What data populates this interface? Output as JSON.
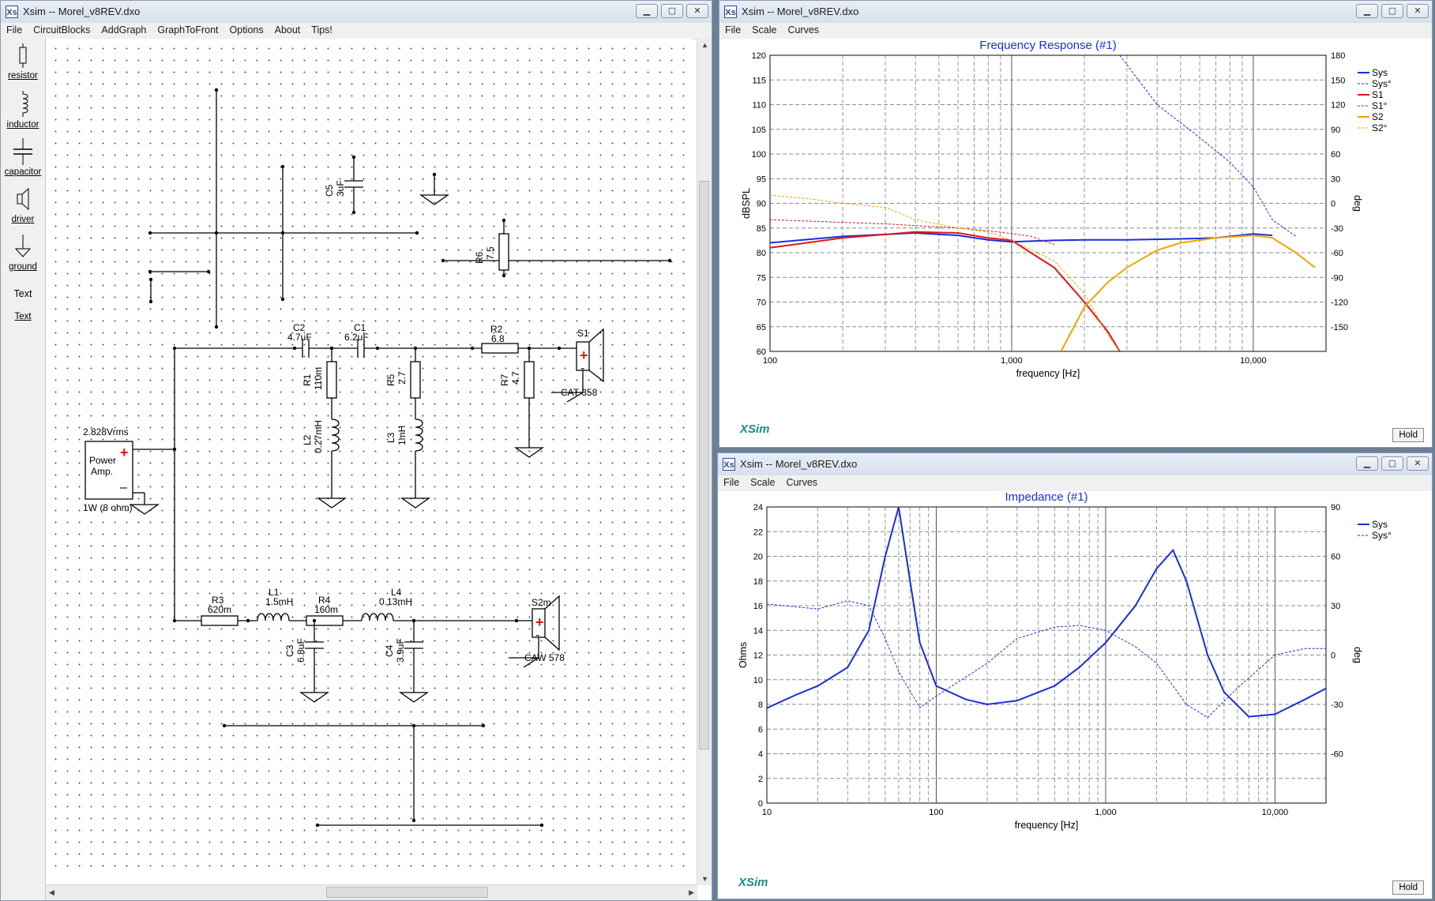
{
  "left_window": {
    "title": "Xsim -- Morel_v8REV.dxo",
    "menu": [
      "File",
      "CircuitBlocks",
      "AddGraph",
      "GraphToFront",
      "Options",
      "About",
      "Tips!"
    ],
    "palette": [
      {
        "label": "resistor",
        "icon": "resistor-icon"
      },
      {
        "label": "inductor",
        "icon": "inductor-icon"
      },
      {
        "label": "capacitor",
        "icon": "capacitor-icon"
      },
      {
        "label": "driver",
        "icon": "speaker-icon"
      },
      {
        "label": "ground",
        "icon": "ground-icon"
      },
      {
        "label": "Text",
        "icon": "text-tool"
      },
      {
        "label": "Text",
        "icon": "text-tool"
      }
    ],
    "schematic": {
      "c5": {
        "ref": "C5",
        "value": "3uF"
      },
      "r6": {
        "ref": "R6",
        "value": "7.5"
      },
      "c2": {
        "ref": "C2",
        "value": "4.7uF"
      },
      "c1": {
        "ref": "C1",
        "value": "6.2uF"
      },
      "r2": {
        "ref": "R2",
        "value": "6.8"
      },
      "s1": {
        "ref": "S1",
        "model": "CAT 358"
      },
      "r1": {
        "ref": "R1",
        "value": "110m"
      },
      "r5": {
        "ref": "R5",
        "value": "2.7"
      },
      "r7": {
        "ref": "R7",
        "value": "4.7"
      },
      "l2": {
        "ref": "L2",
        "value": "0.27mH"
      },
      "l3": {
        "ref": "L3",
        "value": "1mH"
      },
      "amp": {
        "voltage": "2.828Vrms",
        "label_line1": "Power",
        "label_line2": "Amp.",
        "power": "1W (8 ohm)"
      },
      "r3": {
        "ref": "R3",
        "value": "620m"
      },
      "l1": {
        "ref": "L1",
        "value": "1.5mH"
      },
      "r4": {
        "ref": "R4",
        "value": "160m"
      },
      "l4": {
        "ref": "L4",
        "value": "0.13mH"
      },
      "s2": {
        "ref": "S2m",
        "model": "CAW 578"
      },
      "c3": {
        "ref": "C3",
        "value": "6.8uF"
      },
      "c4": {
        "ref": "C4",
        "value": "3.9uF"
      }
    }
  },
  "freq_window": {
    "title": "Xsim -- Morel_v8REV.dxo",
    "menu": [
      "File",
      "Scale",
      "Curves"
    ],
    "hold_label": "Hold",
    "brand": "XSim",
    "chart_data": {
      "type": "line",
      "title": "Frequency Response (#1)",
      "xlabel": "frequency [Hz]",
      "ylabel": "dBSPL",
      "y2label": "deg",
      "x_scale": "log",
      "xlim": [
        100,
        20000
      ],
      "ylim": [
        60,
        120
      ],
      "y2lim": [
        -180,
        180
      ],
      "x_tick_labels": [
        "100",
        "1,000",
        "10,000"
      ],
      "x_ticks": [
        100,
        1000,
        10000
      ],
      "y_ticks": [
        "120",
        "115",
        "110",
        "105",
        "100",
        "95",
        "90",
        "85",
        "80",
        "75",
        "70",
        "65",
        "60"
      ],
      "y2_ticks": [
        "180",
        "150",
        "120",
        "90",
        "60",
        "30",
        "0",
        "-30",
        "-60",
        "-90",
        "-120",
        "-150"
      ],
      "grid": true,
      "legend_position": "top-right",
      "series": [
        {
          "name": "Sys",
          "axis": "left",
          "color": "#1a2de0",
          "style": "solid",
          "points": [
            [
              100,
              82
            ],
            [
              200,
              83.3
            ],
            [
              400,
              84
            ],
            [
              600,
              83.5
            ],
            [
              800,
              82.6
            ],
            [
              1000,
              82.2
            ],
            [
              1500,
              82.5
            ],
            [
              2000,
              82.6
            ],
            [
              3000,
              82.6
            ],
            [
              5000,
              82.8
            ],
            [
              7000,
              83
            ],
            [
              10000,
              83.8
            ],
            [
              12000,
              83.5
            ]
          ]
        },
        {
          "name": "Sys°",
          "axis": "right",
          "color": "#1a2de0",
          "style": "dashed",
          "points": [
            [
              2800,
              180
            ],
            [
              4000,
              120
            ],
            [
              6000,
              80
            ],
            [
              8000,
              50
            ],
            [
              10000,
              20
            ],
            [
              12000,
              -20
            ],
            [
              15000,
              -40
            ]
          ]
        },
        {
          "name": "S1",
          "axis": "left",
          "color": "#e01818",
          "style": "solid",
          "points": [
            [
              100,
              81
            ],
            [
              200,
              83
            ],
            [
              400,
              84.2
            ],
            [
              600,
              84
            ],
            [
              800,
              83
            ],
            [
              1000,
              82.5
            ],
            [
              1200,
              80
            ],
            [
              1500,
              77
            ],
            [
              2000,
              70
            ],
            [
              2500,
              64
            ],
            [
              2800,
              60
            ]
          ]
        },
        {
          "name": "S1°",
          "axis": "right",
          "color": "#e01818",
          "style": "dashed",
          "points": [
            [
              100,
              -20
            ],
            [
              300,
              -25
            ],
            [
              600,
              -30
            ],
            [
              900,
              -35
            ],
            [
              1200,
              -40
            ],
            [
              1500,
              -50
            ]
          ]
        },
        {
          "name": "S2",
          "axis": "left",
          "color": "#f2a400",
          "style": "solid",
          "points": [
            [
              1600,
              60
            ],
            [
              2000,
              69
            ],
            [
              2500,
              74
            ],
            [
              3000,
              77
            ],
            [
              4000,
              80.5
            ],
            [
              5000,
              82
            ],
            [
              7000,
              83
            ],
            [
              10000,
              83.5
            ],
            [
              12000,
              83
            ],
            [
              15000,
              80
            ],
            [
              18000,
              77
            ]
          ]
        },
        {
          "name": "S2°",
          "axis": "right",
          "color": "#f2a400",
          "style": "dashed",
          "points": [
            [
              100,
              10
            ],
            [
              150,
              5
            ],
            [
              200,
              0
            ],
            [
              300,
              -5
            ],
            [
              400,
              -20
            ],
            [
              600,
              -30
            ],
            [
              800,
              -35
            ],
            [
              1000,
              -45
            ],
            [
              1500,
              -70
            ],
            [
              2000,
              -110
            ],
            [
              2500,
              -160
            ],
            [
              2800,
              -180
            ]
          ]
        }
      ]
    }
  },
  "imp_window": {
    "title": "Xsim -- Morel_v8REV.dxo",
    "menu": [
      "File",
      "Scale",
      "Curves"
    ],
    "hold_label": "Hold",
    "brand": "XSim",
    "chart_data": {
      "type": "line",
      "title": "Impedance (#1)",
      "xlabel": "frequency [Hz]",
      "ylabel": "Ohms",
      "y2label": "deg",
      "x_scale": "log",
      "xlim": [
        10,
        20000
      ],
      "ylim": [
        0,
        24
      ],
      "y2lim": [
        -90,
        90
      ],
      "x_tick_labels": [
        "10",
        "100",
        "1,000",
        "10,000"
      ],
      "x_ticks": [
        10,
        100,
        1000,
        10000
      ],
      "y_ticks": [
        "24",
        "22",
        "20",
        "18",
        "16",
        "14",
        "12",
        "10",
        "8",
        "6",
        "4",
        "2",
        "0"
      ],
      "y2_ticks": [
        "90",
        "60",
        "30",
        "0",
        "-30",
        "-60"
      ],
      "grid": true,
      "legend_position": "top-right",
      "series": [
        {
          "name": "Sys",
          "axis": "left",
          "color": "#1a2de0",
          "style": "solid",
          "points": [
            [
              10,
              7.7
            ],
            [
              15,
              8.8
            ],
            [
              20,
              9.5
            ],
            [
              30,
              11
            ],
            [
              40,
              14
            ],
            [
              50,
              20
            ],
            [
              60,
              24
            ],
            [
              70,
              18
            ],
            [
              80,
              13
            ],
            [
              100,
              9.5
            ],
            [
              150,
              8.4
            ],
            [
              200,
              8
            ],
            [
              300,
              8.3
            ],
            [
              500,
              9.5
            ],
            [
              700,
              11
            ],
            [
              1000,
              13
            ],
            [
              1500,
              16
            ],
            [
              2000,
              19
            ],
            [
              2500,
              20.5
            ],
            [
              3000,
              18
            ],
            [
              4000,
              12
            ],
            [
              5000,
              9
            ],
            [
              7000,
              7
            ],
            [
              10000,
              7.2
            ],
            [
              15000,
              8.4
            ],
            [
              20000,
              9.3
            ]
          ]
        },
        {
          "name": "Sys°",
          "axis": "right",
          "color": "#1a2de0",
          "style": "dashed",
          "points": [
            [
              10,
              31
            ],
            [
              20,
              28
            ],
            [
              30,
              33
            ],
            [
              40,
              30
            ],
            [
              50,
              10
            ],
            [
              60,
              -10
            ],
            [
              80,
              -32
            ],
            [
              100,
              -25
            ],
            [
              200,
              -5
            ],
            [
              300,
              10
            ],
            [
              500,
              17
            ],
            [
              700,
              18
            ],
            [
              1000,
              15
            ],
            [
              1500,
              5
            ],
            [
              2000,
              -5
            ],
            [
              3000,
              -30
            ],
            [
              4000,
              -38
            ],
            [
              6000,
              -20
            ],
            [
              10000,
              0
            ],
            [
              15000,
              4
            ],
            [
              20000,
              4
            ]
          ]
        }
      ]
    }
  }
}
